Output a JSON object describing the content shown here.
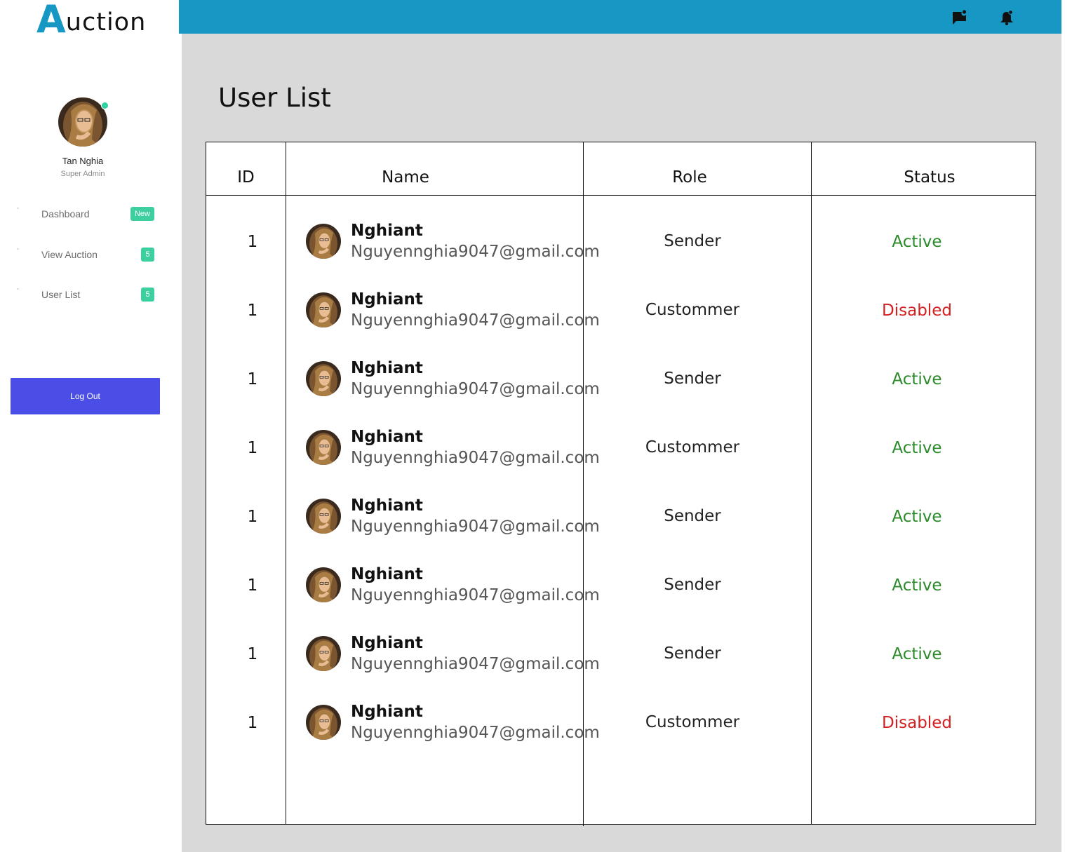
{
  "app": {
    "logo_initial": "A",
    "logo_rest": "uction"
  },
  "profile": {
    "name": "Tan Nghia",
    "role": "Super Admin"
  },
  "sidebar": {
    "items": [
      {
        "label": "Dashboard",
        "badge": "New"
      },
      {
        "label": "View Auction",
        "badge": "5"
      },
      {
        "label": "User List",
        "badge": "5"
      }
    ],
    "logout_label": "Log Out"
  },
  "topbar": {
    "icons": [
      "message-notification-icon",
      "bell-notification-icon"
    ]
  },
  "main": {
    "title": "User List",
    "table": {
      "columns": [
        "ID",
        "Name",
        "Role",
        "Status"
      ],
      "rows": [
        {
          "id": "1",
          "name": "Nghiant",
          "email": "Nguyennghia9047@gmail.com",
          "role": "Sender",
          "status": "Active"
        },
        {
          "id": "1",
          "name": "Nghiant",
          "email": "Nguyennghia9047@gmail.com",
          "role": "Custommer",
          "status": "Disabled"
        },
        {
          "id": "1",
          "name": "Nghiant",
          "email": "Nguyennghia9047@gmail.com",
          "role": "Sender",
          "status": "Active"
        },
        {
          "id": "1",
          "name": "Nghiant",
          "email": "Nguyennghia9047@gmail.com",
          "role": "Custommer",
          "status": "Active"
        },
        {
          "id": "1",
          "name": "Nghiant",
          "email": "Nguyennghia9047@gmail.com",
          "role": "Sender",
          "status": "Active"
        },
        {
          "id": "1",
          "name": "Nghiant",
          "email": "Nguyennghia9047@gmail.com",
          "role": "Sender",
          "status": "Active"
        },
        {
          "id": "1",
          "name": "Nghiant",
          "email": "Nguyennghia9047@gmail.com",
          "role": "Sender",
          "status": "Active"
        },
        {
          "id": "1",
          "name": "Nghiant",
          "email": "Nguyennghia9047@gmail.com",
          "role": "Custommer",
          "status": "Disabled"
        }
      ]
    }
  },
  "colors": {
    "topbar": "#1697c4",
    "accent_logo": "#1697c4",
    "badge": "#3ecfa0",
    "logout_button": "#4a4de6",
    "status_active": "#2a8a2a",
    "status_disabled": "#d32020",
    "content_bg": "#d9d9d9"
  }
}
